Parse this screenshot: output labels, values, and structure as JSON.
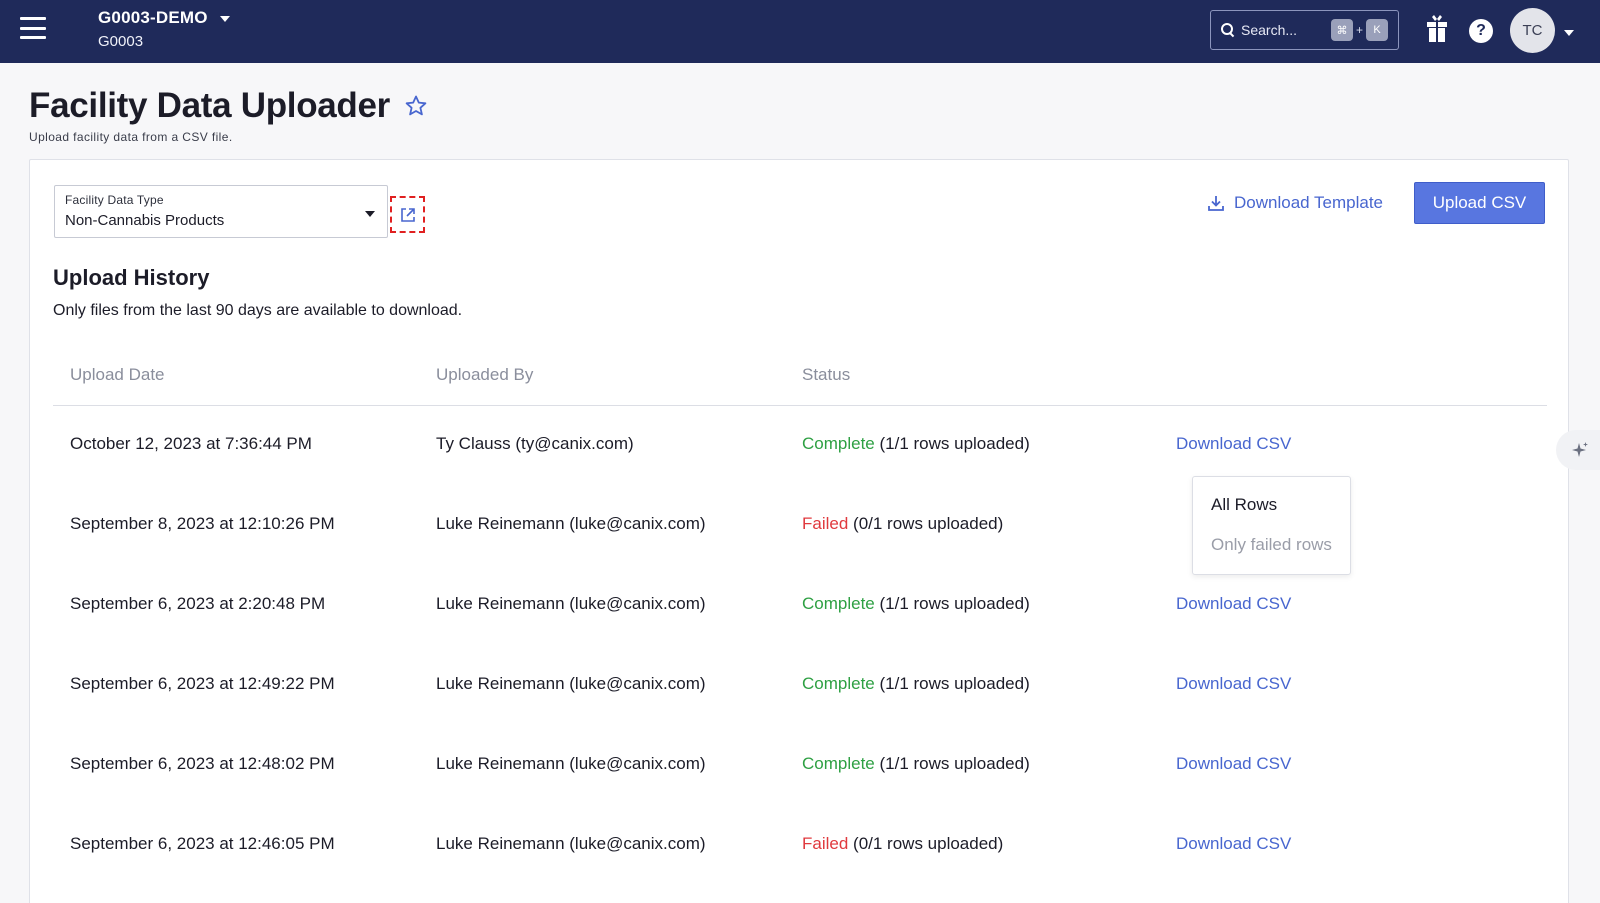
{
  "topbar": {
    "org_name": "G0003-DEMO",
    "org_id": "G0003",
    "search_placeholder": "Search...",
    "shortcut_key1": "⌘",
    "shortcut_plus": "+",
    "shortcut_key2": "K",
    "help_label": "?",
    "avatar_initials": "TC"
  },
  "page": {
    "title": "Facility Data Uploader",
    "subtitle": "Upload facility data from a CSV file."
  },
  "controls": {
    "select_label": "Facility Data Type",
    "select_value": "Non-Cannabis Products",
    "download_template_label": "Download Template",
    "upload_button_label": "Upload CSV"
  },
  "history": {
    "title": "Upload History",
    "note": "Only files from the last 90 days are available to download.",
    "columns": [
      "Upload Date",
      "Uploaded By",
      "Status"
    ],
    "rows": [
      {
        "date": "October 12, 2023 at 7:36:44 PM",
        "by": "Ty Clauss (ty@canix.com)",
        "status": "Complete",
        "detail": " (1/1 rows uploaded)",
        "action": "Download CSV"
      },
      {
        "date": "September 8, 2023 at 12:10:26 PM",
        "by": "Luke Reinemann (luke@canix.com)",
        "status": "Failed",
        "detail": " (0/1 rows uploaded)",
        "action": ""
      },
      {
        "date": "September 6, 2023 at 2:20:48 PM",
        "by": "Luke Reinemann (luke@canix.com)",
        "status": "Complete",
        "detail": " (1/1 rows uploaded)",
        "action": "Download CSV"
      },
      {
        "date": "September 6, 2023 at 12:49:22 PM",
        "by": "Luke Reinemann (luke@canix.com)",
        "status": "Complete",
        "detail": " (1/1 rows uploaded)",
        "action": "Download CSV"
      },
      {
        "date": "September 6, 2023 at 12:48:02 PM",
        "by": "Luke Reinemann (luke@canix.com)",
        "status": "Complete",
        "detail": " (1/1 rows uploaded)",
        "action": "Download CSV"
      },
      {
        "date": "September 6, 2023 at 12:46:05 PM",
        "by": "Luke Reinemann (luke@canix.com)",
        "status": "Failed",
        "detail": " (0/1 rows uploaded)",
        "action": "Download CSV"
      }
    ]
  },
  "dropdown": {
    "items": [
      "All Rows",
      "Only failed rows"
    ]
  },
  "colors": {
    "topbar_bg": "#1f2a5a",
    "accent": "#4866cf",
    "button_bg": "#5876e0",
    "complete": "#2ea043",
    "failed": "#e0393e"
  }
}
